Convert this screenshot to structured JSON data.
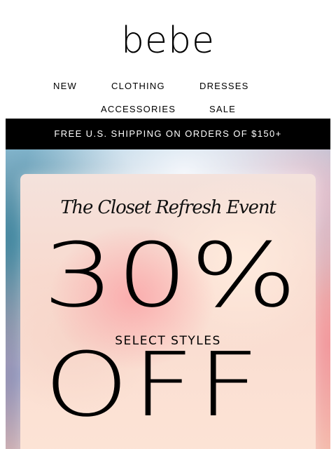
{
  "brand": {
    "logo_text": "bebe"
  },
  "nav": {
    "items": [
      {
        "label": "NEW"
      },
      {
        "label": "CLOTHING"
      },
      {
        "label": "DRESSES"
      },
      {
        "label": "ACCESSORIES"
      },
      {
        "label": "SALE"
      }
    ]
  },
  "shipping_bar": {
    "text": "FREE U.S. SHIPPING ON ORDERS OF $150+"
  },
  "hero": {
    "event_title": "The Closet Refresh Event",
    "discount": "30%",
    "subtext": "SELECT STYLES",
    "off_text": "OFF"
  },
  "colors": {
    "text": "#000000",
    "bar_background": "#000000",
    "bar_text": "#ffffff",
    "page_background": "#ffffff"
  }
}
